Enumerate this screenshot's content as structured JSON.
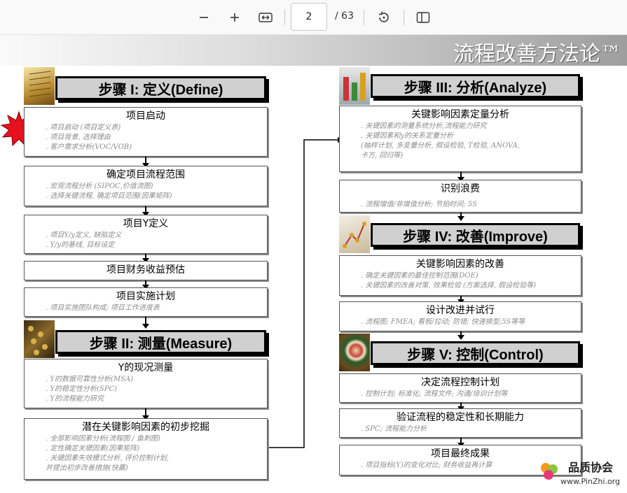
{
  "toolbar": {
    "page_current": "2",
    "page_total": "/ 63",
    "zoom_out_icon": "minus-icon",
    "zoom_in_icon": "plus-icon",
    "fit_icon": "fit-width-icon",
    "rotate_icon": "rotate-icon",
    "view_icon": "page-view-icon"
  },
  "slide": {
    "title": "流程改善方法论™",
    "steps": {
      "s1": "步骤 I:  定义(Define)",
      "s2": "步骤 II: 测量(Measure)",
      "s3": "步骤 III:  分析(Analyze)",
      "s4": "步骤 IV:  改善(Improve)",
      "s5": "步骤 V:  控制(Control)"
    },
    "boxes": {
      "b1": {
        "title": "项目启动",
        "lines": [
          ". 项目启动 (项目定义表)",
          ". 项目背景, 选择理由",
          ". 客户需求分析(VOC/VOB)"
        ]
      },
      "b2": {
        "title": "确定项目流程范围",
        "lines": [
          ". 宏观流程分析 (SIPOC,价值流图)",
          ". 选择关键流程, 确定项目范围(因果矩阵)"
        ]
      },
      "b3": {
        "title": "项目Y定义",
        "lines": [
          ". 项目Y/y定义, 缺陷定义",
          ". Y/y的基线, 目标设定"
        ]
      },
      "b4": {
        "title": "项目财务收益预估",
        "lines": []
      },
      "b5": {
        "title": "项目实施计划",
        "lines": [
          ". 项目实施团队构成; 项目工作进度表"
        ]
      },
      "b6": {
        "title": "Y的现况测量",
        "lines": [
          ". Y的数据可靠性分析(MSA)",
          ". Y的稳定性分析(SPC)",
          ". Y的流程能力研究"
        ]
      },
      "b7": {
        "title": "潜在关键影响因素的初步挖掘",
        "lines": [
          ". 全部影响因素分析(流程图 / 鱼刺图)",
          ". 定性确定关键因素(因果矩阵)",
          ". 关键因素失效模式分析, 评价控制计划,",
          "  并提出初步改善措施(快赢)"
        ]
      },
      "b8": {
        "title": "关键影响因素定量分析",
        "lines": [
          ". 关键因素的测量系统分析,流程能力研究",
          ". 关键因素和y的关系定量分析",
          "(抽样计划, 多变量分析, 假设检验, T检验, ANOVA,",
          "卡方, 回归等)"
        ]
      },
      "b9": {
        "title": "识别浪费",
        "lines": [
          ". 流程增值/非增值分析; 节拍时间; 5S"
        ]
      },
      "b10": {
        "title": "关键影响因素的改善",
        "lines": [
          ". 确定关键因素的最佳控制范围(DOE)",
          ". 关键因素的改善对策, 效果检验 (方案选择, 假设检验等)"
        ]
      },
      "b11": {
        "title": "设计改进并试行",
        "lines": [
          ". 流程图; FMEA; 看板/拉动; 防错; 快速换型;5S等等"
        ]
      },
      "b12": {
        "title": "决定流程控制计划",
        "lines": [
          ". 控制计划; 标准化; 流程文件; 沟通/培训计划等"
        ]
      },
      "b13": {
        "title": "验证流程的稳定性和长期能力",
        "lines": [
          ". SPC; 流程能力分析"
        ]
      },
      "b14": {
        "title": "项目最终成果",
        "lines": [
          ". 项目指标(Y)的变化对比; 财务收益再计算"
        ]
      }
    }
  },
  "watermark": {
    "text": "品质协会",
    "url": "www.PinZhi.org"
  }
}
